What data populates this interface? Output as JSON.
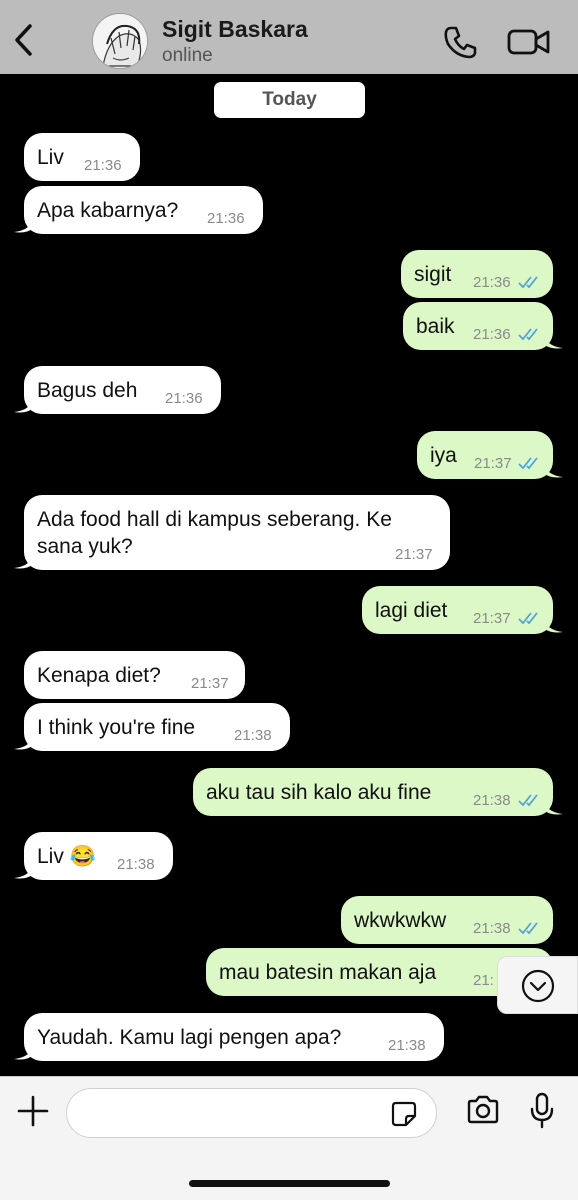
{
  "header": {
    "back_icon": "chevron-left-icon",
    "contact_name": "Sigit Baskara",
    "status": "online",
    "call_icon": "phone-icon",
    "video_icon": "video-camera-icon"
  },
  "date_chip": "Today",
  "messages": [
    {
      "dir": "in",
      "text": "Liv",
      "time": "21:36"
    },
    {
      "dir": "in",
      "text": "Apa kabarnya?",
      "time": "21:36"
    },
    {
      "dir": "out",
      "text": "sigit",
      "time": "21:36",
      "read": true
    },
    {
      "dir": "out",
      "text": "baik",
      "time": "21:36",
      "read": true
    },
    {
      "dir": "in",
      "text": "Bagus deh",
      "time": "21:36"
    },
    {
      "dir": "out",
      "text": "iya",
      "time": "21:37",
      "read": true
    },
    {
      "dir": "in",
      "text_line1": "Ada food hall di kampus seberang. Ke",
      "text_line2": "sana yuk?",
      "time": "21:37"
    },
    {
      "dir": "out",
      "text": "lagi diet",
      "time": "21:37",
      "read": true
    },
    {
      "dir": "in",
      "text": "Kenapa diet?",
      "time": "21:37"
    },
    {
      "dir": "in",
      "text": "I think you're fine",
      "time": "21:38"
    },
    {
      "dir": "out",
      "text": "aku tau sih kalo aku fine",
      "time": "21:38",
      "read": true
    },
    {
      "dir": "in",
      "text": "Liv 😂",
      "time": "21:38"
    },
    {
      "dir": "out",
      "text": "wkwkwkw",
      "time": "21:38",
      "read": true
    },
    {
      "dir": "out",
      "text": "mau batesin makan aja",
      "time": "21:",
      "read": true
    },
    {
      "dir": "in",
      "text": "Yaudah. Kamu lagi pengen apa?",
      "time": "21:38"
    }
  ],
  "scroll_icon": "chevron-down-circle-icon",
  "composer": {
    "placeholder": "",
    "plus_icon": "plus-icon",
    "sticker_icon": "sticker-icon",
    "camera_icon": "camera-icon",
    "mic_icon": "microphone-icon"
  },
  "colors": {
    "header_bg": "#bcbcbc",
    "incoming_bubble": "#ffffff",
    "outgoing_bubble": "#dcf8c6",
    "read_ticks": "#4fa3e0",
    "chat_bg": "#000000"
  }
}
